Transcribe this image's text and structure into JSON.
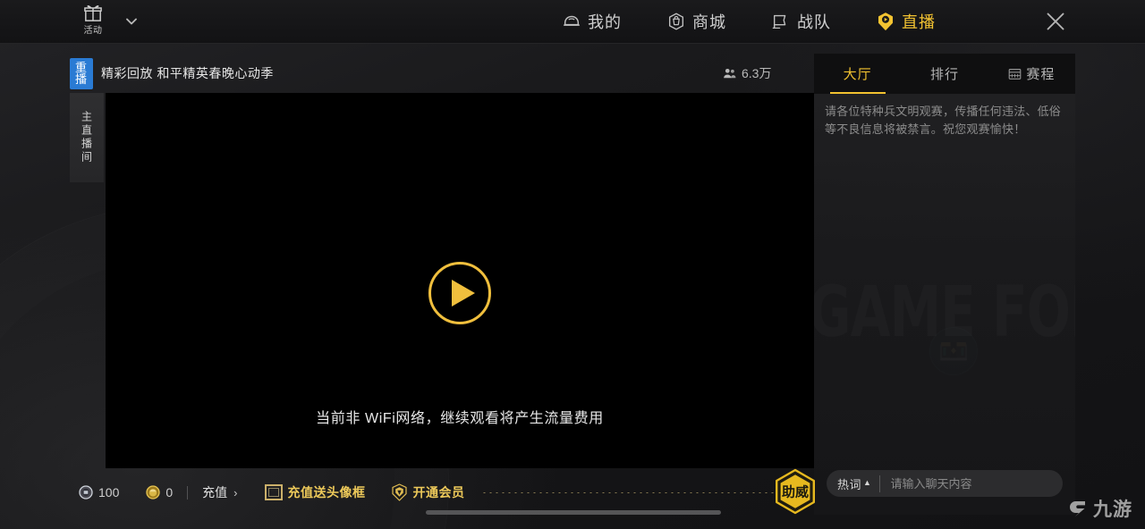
{
  "topbar": {
    "activity": {
      "label": "活动",
      "icon": "gift-icon"
    },
    "nav": [
      {
        "label": "我的",
        "icon": "helmet-icon",
        "active": false
      },
      {
        "label": "商城",
        "icon": "shop-bag-icon",
        "active": false
      },
      {
        "label": "战队",
        "icon": "team-flag-icon",
        "active": false
      },
      {
        "label": "直播",
        "icon": "live-badge-icon",
        "active": true
      }
    ],
    "close_icon": "close-icon"
  },
  "stream": {
    "badge": "重播",
    "title": "精彩回放 和平精英春晚心动季",
    "viewers": "6.3万",
    "viewers_icon": "people-icon",
    "room_tab": "主直播间"
  },
  "player": {
    "play_icon": "play-icon",
    "message": "当前非 WiFi网络，继续观看将产生流量费用"
  },
  "chat": {
    "tabs": [
      {
        "label": "大厅",
        "icon": null,
        "active": true
      },
      {
        "label": "排行",
        "icon": null,
        "active": false
      },
      {
        "label": "赛程",
        "icon": "calendar-icon",
        "active": false
      }
    ],
    "notice": "请各位特种兵文明观赛，传播任何违法、低俗等不良信息将被禁言。祝您观赛愉快！",
    "background_watermark": "GAME FOR PEACE",
    "avatar_icon": "crate-avatar-icon",
    "hotword_label": "热词",
    "hotword_caret": "▲",
    "input_placeholder": "请输入聊天内容",
    "input_value": ""
  },
  "bottombar": {
    "silver_coin": {
      "icon": "silver-coin-icon",
      "value": "100"
    },
    "gold_coin": {
      "icon": "gold-coin-icon",
      "value": "0"
    },
    "recharge": {
      "label": "充值",
      "arrow": "›"
    },
    "promo": {
      "label": "充值送头像框",
      "icon": "avatar-frame-icon"
    },
    "vip": {
      "label": "开通会员",
      "icon": "vip-crest-icon"
    },
    "cheer": {
      "label": "助威",
      "icon": "cheer-hexagon-icon"
    }
  },
  "watermark": {
    "text": "九游",
    "icon": "nine-game-logo-icon"
  },
  "colors": {
    "accent_gold": "#f2c230",
    "badge_blue": "#2a7bd4",
    "promo_gold": "#edc95a",
    "panel_bg": "#1a1a1c",
    "stage_bg": "#000000"
  }
}
